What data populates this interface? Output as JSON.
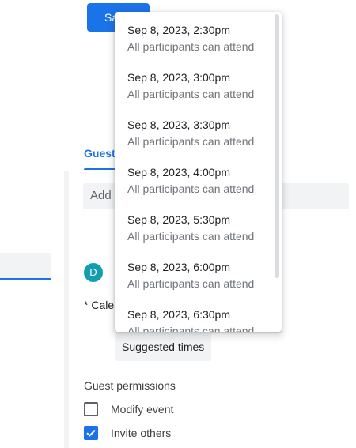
{
  "toolbar": {
    "save_label": "Sa"
  },
  "tabs": {
    "guests_label": "Guest"
  },
  "guests": {
    "add_placeholder": "Add g",
    "avatar_initial": "D"
  },
  "calendar": {
    "label": "* Calen"
  },
  "suggested_times": {
    "label": "Suggested times"
  },
  "guest_permissions": {
    "heading": "Guest permissions",
    "items": [
      {
        "label": "Modify event",
        "checked": false
      },
      {
        "label": "Invite others",
        "checked": true
      }
    ]
  },
  "time_dropdown": {
    "options": [
      {
        "time": "Sep 8, 2023, 2:30pm",
        "availability": "All participants can attend"
      },
      {
        "time": "Sep 8, 2023, 3:00pm",
        "availability": "All participants can attend"
      },
      {
        "time": "Sep 8, 2023, 3:30pm",
        "availability": "All participants can attend"
      },
      {
        "time": "Sep 8, 2023, 4:00pm",
        "availability": "All participants can attend"
      },
      {
        "time": "Sep 8, 2023, 5:30pm",
        "availability": "All participants can attend"
      },
      {
        "time": "Sep 8, 2023, 6:00pm",
        "availability": "All participants can attend"
      },
      {
        "time": "Sep 8, 2023, 6:30pm",
        "availability": "All participants can attend"
      }
    ]
  },
  "colors": {
    "accent": "#1a73e8",
    "avatar": "#129eaf",
    "field_background": "#f1f3f4",
    "secondary_text": "#70757a"
  }
}
